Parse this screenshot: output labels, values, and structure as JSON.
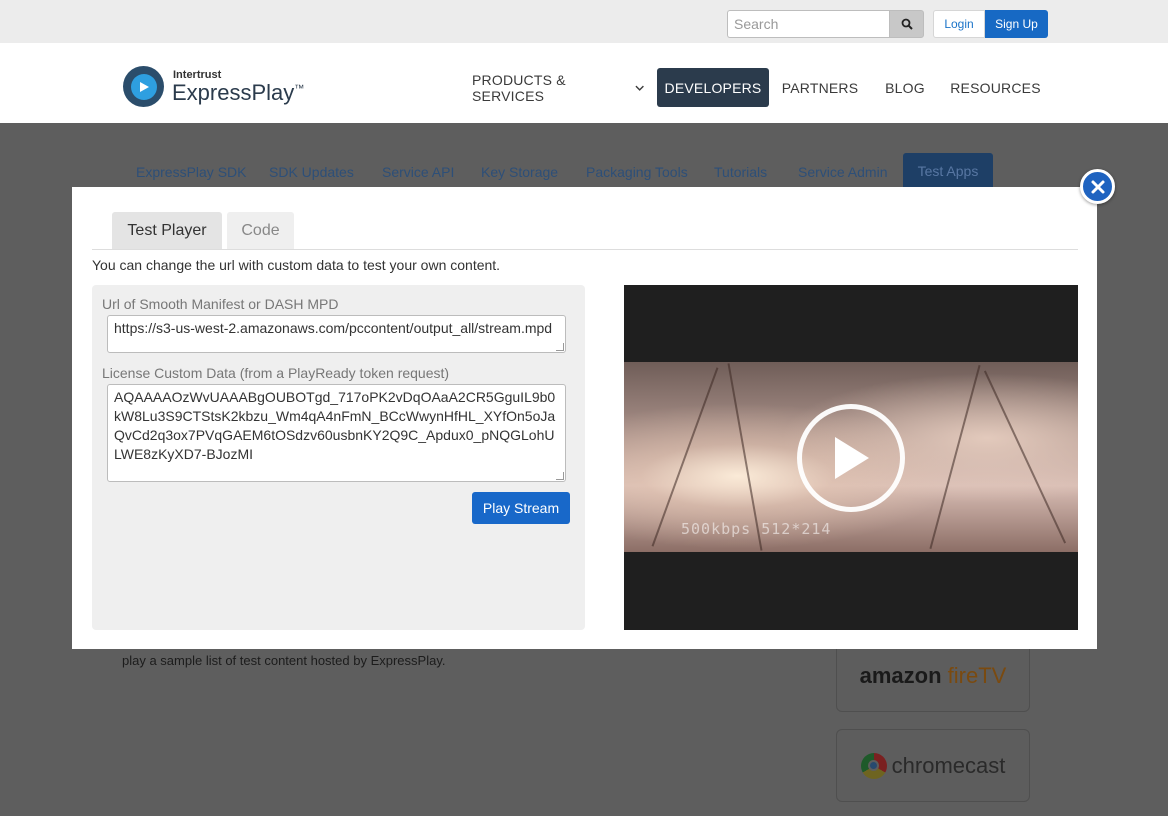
{
  "topbar": {
    "search_placeholder": "Search",
    "search_icon": "search-icon",
    "login_label": "Login",
    "signup_label": "Sign Up"
  },
  "header": {
    "logo_small": "Intertrust",
    "logo_big": "ExpressPlay",
    "logo_tm": "™",
    "nav": [
      {
        "label": "PRODUCTS & SERVICES",
        "active": false,
        "has_dropdown": true
      },
      {
        "label": "DEVELOPERS",
        "active": true
      },
      {
        "label": "PARTNERS",
        "active": false
      },
      {
        "label": "BLOG",
        "active": false
      },
      {
        "label": "RESOURCES",
        "active": false
      }
    ]
  },
  "subnav": [
    {
      "label": "ExpressPlay SDK"
    },
    {
      "label": "SDK Updates"
    },
    {
      "label": "Service API"
    },
    {
      "label": "Key Storage"
    },
    {
      "label": "Packaging Tools"
    },
    {
      "label": "Tutorials"
    },
    {
      "label": "Service Admin"
    },
    {
      "label": "Test Apps",
      "active": true
    }
  ],
  "background": {
    "text": "play a sample list of test content hosted by ExpressPlay.",
    "devices": [
      "amazon",
      "fireTV",
      "chromecast"
    ]
  },
  "modal": {
    "tabs": [
      {
        "label": "Test Player",
        "active": true
      },
      {
        "label": "Code",
        "active": false
      }
    ],
    "intro": "You can change the url with custom data to test your own content.",
    "url_label": "Url of Smooth Manifest or DASH MPD",
    "url_value": "https://s3-us-west-2.amazonaws.com/pccontent/output_all/stream.mpd",
    "license_label": "License Custom Data (from a PlayReady token request)",
    "license_value": "AQAAAAOzWvUAAABgOUBOTgd_717oPK2vDqOAaA2CR5GguIL9b0kW8Lu3S9CTStsK2kbzu_Wm4qA4nFmN_BCcWwynHfHL_XYfOn5oJaQvCd2q3ox7PVqGAEM6tOSdzv60usbnKY2Q9C_Apdux0_pNQGLohULWE8zKyXD7-BJozMI",
    "play_button": "Play Stream",
    "video_overlay": "500kbps 512*214",
    "close_icon": "close-icon"
  },
  "colors": {
    "brand_blue": "#1769c4",
    "nav_dark": "#2b3b4c",
    "overlay": "#5e5e5e"
  }
}
